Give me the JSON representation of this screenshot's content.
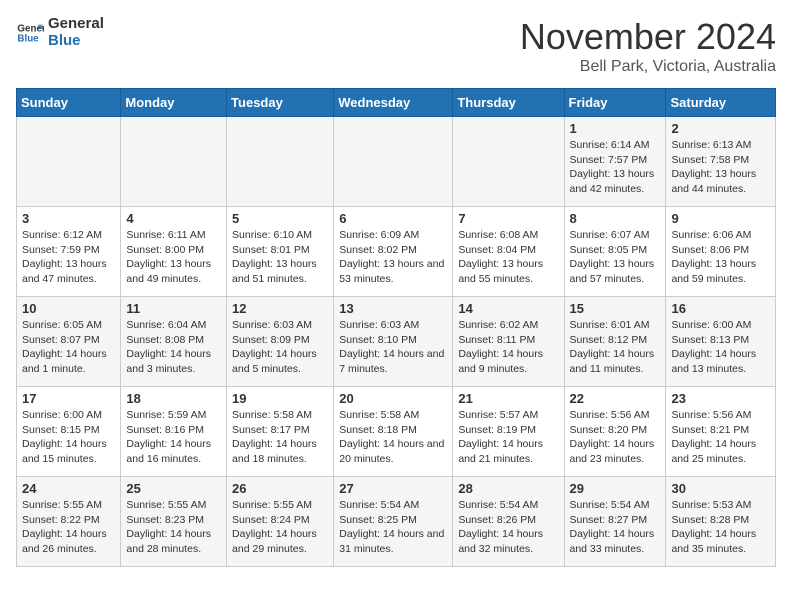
{
  "header": {
    "logo_line1": "General",
    "logo_line2": "Blue",
    "title": "November 2024",
    "subtitle": "Bell Park, Victoria, Australia"
  },
  "days_of_week": [
    "Sunday",
    "Monday",
    "Tuesday",
    "Wednesday",
    "Thursday",
    "Friday",
    "Saturday"
  ],
  "weeks": [
    [
      {
        "day": "",
        "content": ""
      },
      {
        "day": "",
        "content": ""
      },
      {
        "day": "",
        "content": ""
      },
      {
        "day": "",
        "content": ""
      },
      {
        "day": "",
        "content": ""
      },
      {
        "day": "1",
        "content": "Sunrise: 6:14 AM\nSunset: 7:57 PM\nDaylight: 13 hours and 42 minutes."
      },
      {
        "day": "2",
        "content": "Sunrise: 6:13 AM\nSunset: 7:58 PM\nDaylight: 13 hours and 44 minutes."
      }
    ],
    [
      {
        "day": "3",
        "content": "Sunrise: 6:12 AM\nSunset: 7:59 PM\nDaylight: 13 hours and 47 minutes."
      },
      {
        "day": "4",
        "content": "Sunrise: 6:11 AM\nSunset: 8:00 PM\nDaylight: 13 hours and 49 minutes."
      },
      {
        "day": "5",
        "content": "Sunrise: 6:10 AM\nSunset: 8:01 PM\nDaylight: 13 hours and 51 minutes."
      },
      {
        "day": "6",
        "content": "Sunrise: 6:09 AM\nSunset: 8:02 PM\nDaylight: 13 hours and 53 minutes."
      },
      {
        "day": "7",
        "content": "Sunrise: 6:08 AM\nSunset: 8:04 PM\nDaylight: 13 hours and 55 minutes."
      },
      {
        "day": "8",
        "content": "Sunrise: 6:07 AM\nSunset: 8:05 PM\nDaylight: 13 hours and 57 minutes."
      },
      {
        "day": "9",
        "content": "Sunrise: 6:06 AM\nSunset: 8:06 PM\nDaylight: 13 hours and 59 minutes."
      }
    ],
    [
      {
        "day": "10",
        "content": "Sunrise: 6:05 AM\nSunset: 8:07 PM\nDaylight: 14 hours and 1 minute."
      },
      {
        "day": "11",
        "content": "Sunrise: 6:04 AM\nSunset: 8:08 PM\nDaylight: 14 hours and 3 minutes."
      },
      {
        "day": "12",
        "content": "Sunrise: 6:03 AM\nSunset: 8:09 PM\nDaylight: 14 hours and 5 minutes."
      },
      {
        "day": "13",
        "content": "Sunrise: 6:03 AM\nSunset: 8:10 PM\nDaylight: 14 hours and 7 minutes."
      },
      {
        "day": "14",
        "content": "Sunrise: 6:02 AM\nSunset: 8:11 PM\nDaylight: 14 hours and 9 minutes."
      },
      {
        "day": "15",
        "content": "Sunrise: 6:01 AM\nSunset: 8:12 PM\nDaylight: 14 hours and 11 minutes."
      },
      {
        "day": "16",
        "content": "Sunrise: 6:00 AM\nSunset: 8:13 PM\nDaylight: 14 hours and 13 minutes."
      }
    ],
    [
      {
        "day": "17",
        "content": "Sunrise: 6:00 AM\nSunset: 8:15 PM\nDaylight: 14 hours and 15 minutes."
      },
      {
        "day": "18",
        "content": "Sunrise: 5:59 AM\nSunset: 8:16 PM\nDaylight: 14 hours and 16 minutes."
      },
      {
        "day": "19",
        "content": "Sunrise: 5:58 AM\nSunset: 8:17 PM\nDaylight: 14 hours and 18 minutes."
      },
      {
        "day": "20",
        "content": "Sunrise: 5:58 AM\nSunset: 8:18 PM\nDaylight: 14 hours and 20 minutes."
      },
      {
        "day": "21",
        "content": "Sunrise: 5:57 AM\nSunset: 8:19 PM\nDaylight: 14 hours and 21 minutes."
      },
      {
        "day": "22",
        "content": "Sunrise: 5:56 AM\nSunset: 8:20 PM\nDaylight: 14 hours and 23 minutes."
      },
      {
        "day": "23",
        "content": "Sunrise: 5:56 AM\nSunset: 8:21 PM\nDaylight: 14 hours and 25 minutes."
      }
    ],
    [
      {
        "day": "24",
        "content": "Sunrise: 5:55 AM\nSunset: 8:22 PM\nDaylight: 14 hours and 26 minutes."
      },
      {
        "day": "25",
        "content": "Sunrise: 5:55 AM\nSunset: 8:23 PM\nDaylight: 14 hours and 28 minutes."
      },
      {
        "day": "26",
        "content": "Sunrise: 5:55 AM\nSunset: 8:24 PM\nDaylight: 14 hours and 29 minutes."
      },
      {
        "day": "27",
        "content": "Sunrise: 5:54 AM\nSunset: 8:25 PM\nDaylight: 14 hours and 31 minutes."
      },
      {
        "day": "28",
        "content": "Sunrise: 5:54 AM\nSunset: 8:26 PM\nDaylight: 14 hours and 32 minutes."
      },
      {
        "day": "29",
        "content": "Sunrise: 5:54 AM\nSunset: 8:27 PM\nDaylight: 14 hours and 33 minutes."
      },
      {
        "day": "30",
        "content": "Sunrise: 5:53 AM\nSunset: 8:28 PM\nDaylight: 14 hours and 35 minutes."
      }
    ]
  ]
}
